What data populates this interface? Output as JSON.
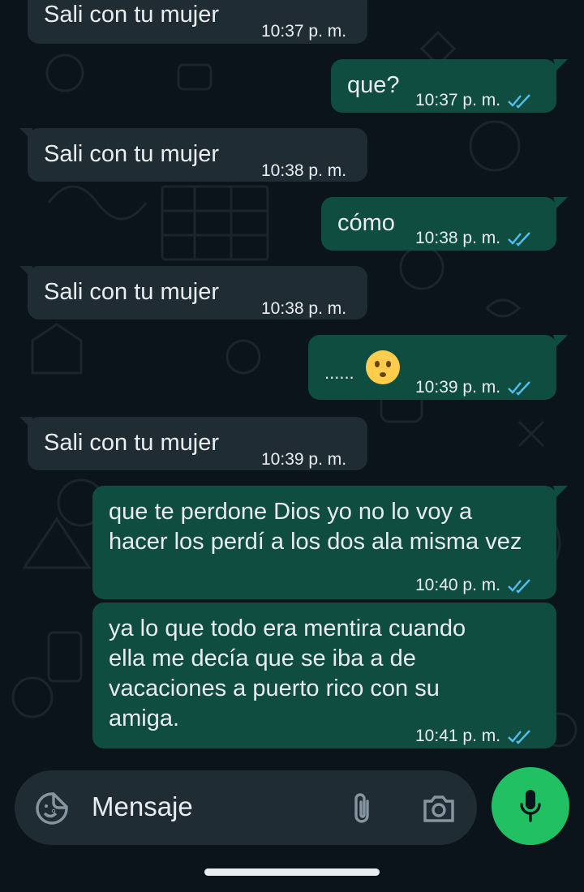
{
  "messages": [
    {
      "direction": "incoming",
      "text": "Sali con tu mujer",
      "time": "10:37 p. m."
    },
    {
      "direction": "outgoing",
      "text": "que?",
      "time": "10:37 p. m."
    },
    {
      "direction": "incoming",
      "text": "Sali con tu mujer",
      "time": "10:38 p. m."
    },
    {
      "direction": "outgoing",
      "text": "cómo",
      "time": "10:38 p. m."
    },
    {
      "direction": "incoming",
      "text": "Sali con tu mujer",
      "time": "10:38 p. m."
    },
    {
      "direction": "outgoing",
      "text": "......",
      "emoji": "🫥",
      "time": "10:39 p. m."
    },
    {
      "direction": "incoming",
      "text": "Sali con tu mujer",
      "time": "10:39 p. m."
    },
    {
      "direction": "outgoing",
      "text": "que te perdone Dios yo no lo voy a hacer los perdí a los dos ala misma vez",
      "time": "10:40 p. m."
    },
    {
      "direction": "outgoing",
      "text": "ya lo que todo era mentira cuando ella me decía que se iba a de vacaciones a puerto rico con su amiga.",
      "time": "10:41 p. m."
    }
  ],
  "composer": {
    "placeholder": "Mensaje",
    "icons": {
      "sticker": "sticker-icon",
      "attach": "paperclip-icon",
      "camera": "camera-icon",
      "mic": "microphone-icon"
    }
  },
  "colors": {
    "background": "#0b141a",
    "incoming_bubble": "#202c33",
    "outgoing_bubble": "#0f4d40",
    "text": "#e9edef",
    "read_ticks": "#53bdeb",
    "mic_button": "#21c063"
  }
}
